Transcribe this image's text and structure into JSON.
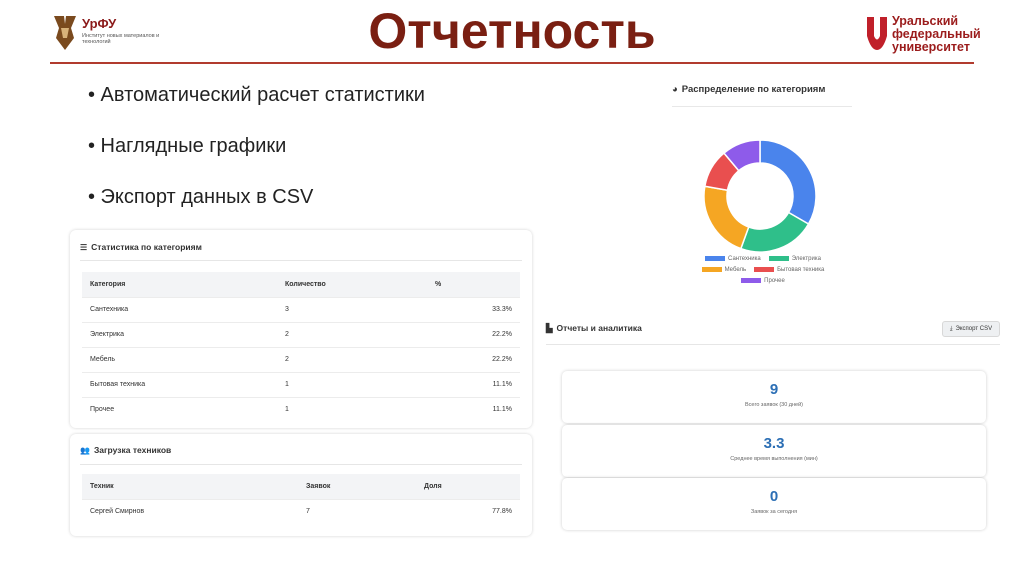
{
  "header": {
    "title": "Отчетность",
    "left_logo": {
      "name": "УрФУ",
      "subtitle": "Институт новых материалов и технологий"
    },
    "right_logo": {
      "line1": "Уральский",
      "line2": "федеральный",
      "line3": "университет"
    },
    "accent_color": "#7a1f12"
  },
  "bullets": [
    "• Автоматический расчет статистики",
    "• Наглядные графики",
    "• Экспорт данных в CSV"
  ],
  "category_stats": {
    "title": "Статистика по категориям",
    "icon": "list-icon",
    "columns": [
      "Категория",
      "Количество",
      "%"
    ],
    "rows": [
      [
        "Сантехника",
        "3",
        "33.3%"
      ],
      [
        "Электрика",
        "2",
        "22.2%"
      ],
      [
        "Мебель",
        "2",
        "22.2%"
      ],
      [
        "Бытовая техника",
        "1",
        "11.1%"
      ],
      [
        "Прочее",
        "1",
        "11.1%"
      ]
    ]
  },
  "technicians": {
    "title": "Загрузка техников",
    "icon": "users-icon",
    "columns": [
      "Техник",
      "Заявок",
      "Доля"
    ],
    "rows": [
      [
        "Сергей Смирнов",
        "7",
        "77.8%"
      ]
    ]
  },
  "chart_data": {
    "type": "pie",
    "title": "Распределение по категориям",
    "donut": true,
    "categories": [
      "Сантехника",
      "Электрика",
      "Мебель",
      "Бытовая техника",
      "Прочее"
    ],
    "values": [
      3,
      2,
      2,
      1,
      1
    ],
    "colors": [
      "#4a84ec",
      "#2fbf8a",
      "#f5a623",
      "#e94f4f",
      "#8e5bea"
    ],
    "legend_position": "bottom"
  },
  "reports": {
    "title": "Отчеты и аналитика",
    "export_label": "Экспорт CSV",
    "stats": [
      {
        "value": "9",
        "label": "Всего заявок (30 дней)"
      },
      {
        "value": "3.3",
        "label": "Среднее время выполнения (мин)"
      },
      {
        "value": "0",
        "label": "Заявок за сегодня"
      }
    ],
    "value_color": "#2c6fb5"
  }
}
